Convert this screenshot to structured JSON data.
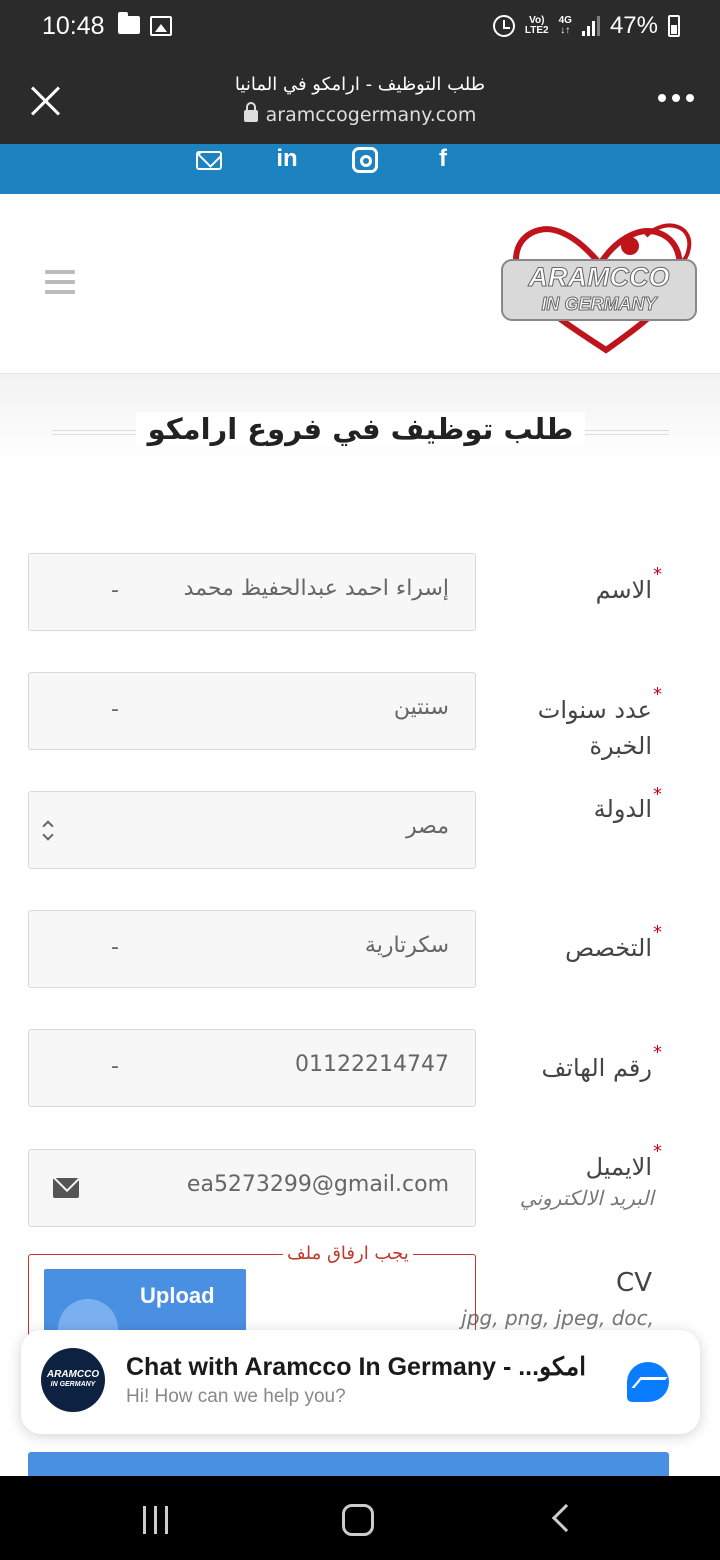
{
  "status_bar": {
    "time": "10:48",
    "network_top": "Vo)",
    "network_bottom": "LTE2",
    "network_type": "4G",
    "battery": "47%"
  },
  "browser": {
    "page_title": "طلب التوظيف - ارامكو في المانيا",
    "url": "aramccogermany.com"
  },
  "social": {
    "icons": [
      "mail-icon",
      "linkedin-icon",
      "instagram-icon",
      "facebook-icon"
    ],
    "linkedin_glyph": "in",
    "facebook_glyph": "f"
  },
  "header": {
    "logo_alt": "ARAMCCO IN GERMANY"
  },
  "form": {
    "heading": "طلب توظيف في فروع ارامكو",
    "fields": {
      "name": {
        "label": "الاسم",
        "value": "إسراء احمد عبدالحفيظ محمد",
        "suffix": "-"
      },
      "experience": {
        "label": "عدد سنوات الخبرة",
        "value": "سنتين",
        "suffix": "-"
      },
      "country": {
        "label": "الدولة",
        "value": "مصر"
      },
      "specialty": {
        "label": "التخصص",
        "value": "سكرتارية",
        "suffix": "-"
      },
      "phone": {
        "label": "رقم الهاتف",
        "value": "01122214747",
        "suffix": "-"
      },
      "email": {
        "label": "الايميل",
        "sublabel": "البريد الالكتروني",
        "value": "ea5273299@gmail.com"
      }
    },
    "required_mark": "*",
    "cv": {
      "label": "CV",
      "types": "jpg, png, jpeg, doc,",
      "error": "يجب ارفاق ملف",
      "upload_label": "Upload"
    }
  },
  "chat": {
    "avatar_line1": "ARAMCCO",
    "avatar_line2": "IN GERMANY",
    "title": "Chat with Aramcco In Germany - ...امكو",
    "subtitle": "Hi! How can we help you?"
  },
  "colors": {
    "social_bar": "#1c82c0",
    "upload": "#4a90e2",
    "error": "#c0392b",
    "required": "#d0021b"
  }
}
